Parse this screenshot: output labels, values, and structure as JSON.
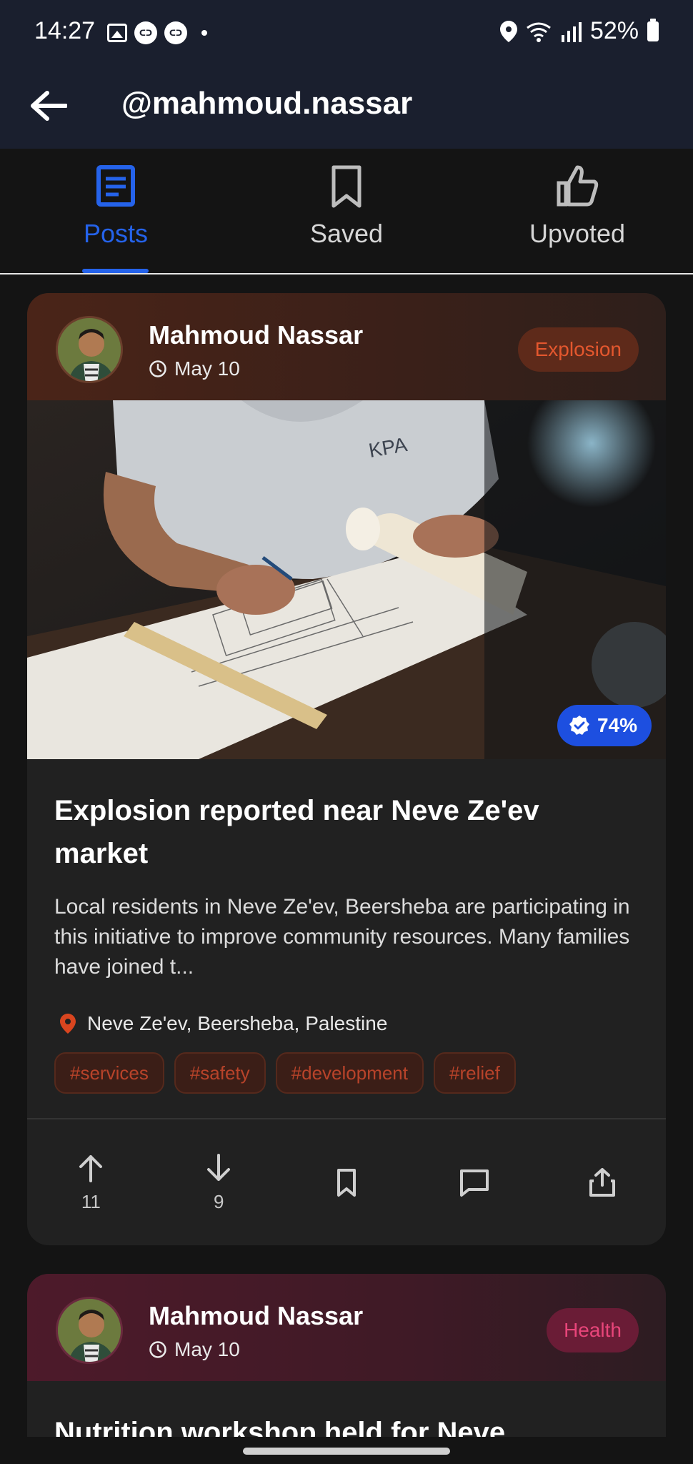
{
  "status_bar": {
    "time": "14:27",
    "battery": "52%"
  },
  "app_bar": {
    "title": "@mahmoud.nassar"
  },
  "tabs": [
    {
      "label": "Posts",
      "active": true,
      "icon": "document-icon"
    },
    {
      "label": "Saved",
      "active": false,
      "icon": "bookmark-icon"
    },
    {
      "label": "Upvoted",
      "active": false,
      "icon": "thumbs-up-icon"
    }
  ],
  "colors": {
    "accent": "#2563eb",
    "explosion": "#e4572e",
    "health": "#e8457a",
    "verify": "#1d4fe0"
  },
  "posts": [
    {
      "author": "Mahmoud Nassar",
      "date": "May 10",
      "category": "Explosion",
      "verification": "74%",
      "title": "Explosion reported near Neve Ze'ev market",
      "description": "Local residents in Neve Ze'ev, Beersheba are participating in this initiative to improve community resources. Many families have joined t...",
      "location": "Neve Ze'ev, Beersheba, Palestine",
      "tags": [
        "#services",
        "#safety",
        "#development",
        "#relief"
      ],
      "upvotes": "11",
      "downvotes": "9"
    },
    {
      "author": "Mahmoud Nassar",
      "date": "May 10",
      "category": "Health",
      "title": "Nutrition workshop held for Neve"
    }
  ]
}
